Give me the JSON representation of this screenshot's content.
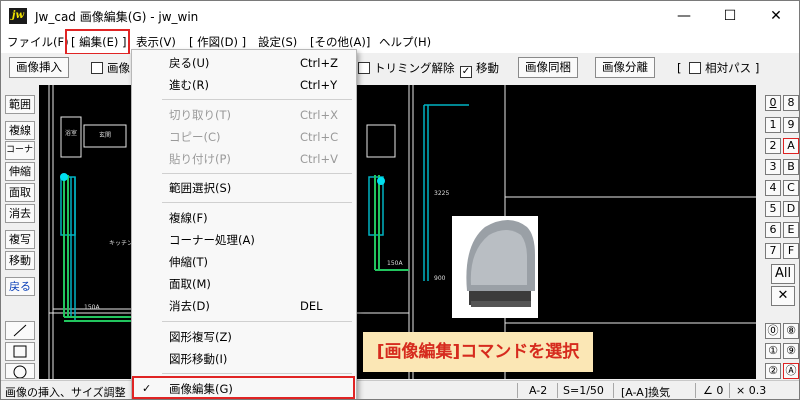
{
  "window": {
    "title": "Jw_cad 画像編集(G) - jw_win",
    "app_icon": "jw",
    "min_glyph": "—",
    "max_glyph": "☐",
    "close_glyph": "✕"
  },
  "menubar": {
    "items": [
      "ファイル(F)",
      "[ 編集(E) ]",
      "表示(V)",
      "[ 作図(D) ]",
      "設定(S)",
      "[その他(A)]",
      "ヘルプ(H)"
    ]
  },
  "toolbar": {
    "insert_image": "画像挿入",
    "image_partial": "画像",
    "trim_cancel": "トリミング解除",
    "move": "移動",
    "move_checked": true,
    "image_sync": "画像同梱",
    "image_split": "画像分離",
    "relative_path": "相対パス",
    "bracket_open": "[",
    "bracket_close": "]"
  },
  "left_palette": [
    "範囲",
    "複線",
    "コーナー",
    "伸縮",
    "面取",
    "消去",
    "複写",
    "移動",
    "戻る"
  ],
  "left_tools": [
    "line-icon",
    "rectangle-icon",
    "circle-icon"
  ],
  "right_palette": {
    "row0": [
      "0",
      "8"
    ],
    "rows": [
      [
        "1",
        "9"
      ],
      [
        "2",
        "A"
      ],
      [
        "3",
        "B"
      ],
      [
        "4",
        "C"
      ],
      [
        "5",
        "D"
      ],
      [
        "6",
        "E"
      ],
      [
        "7",
        "F"
      ]
    ],
    "all": "All",
    "cross": "✕",
    "circled": [
      [
        "⓪",
        "⑧"
      ],
      [
        "①",
        "⑨"
      ],
      [
        "②",
        "Ⓐ"
      ]
    ]
  },
  "edit_menu": {
    "items": [
      {
        "label": "戻る(U)",
        "shortcut": "Ctrl+Z",
        "disabled": false
      },
      {
        "label": "進む(R)",
        "shortcut": "Ctrl+Y",
        "disabled": false
      },
      {
        "label": "切り取り(T)",
        "shortcut": "Ctrl+X",
        "disabled": true
      },
      {
        "label": "コピー(C)",
        "shortcut": "Ctrl+C",
        "disabled": true
      },
      {
        "label": "貼り付け(P)",
        "shortcut": "Ctrl+V",
        "disabled": true
      },
      {
        "label": "範囲選択(S)",
        "shortcut": "",
        "disabled": false
      },
      {
        "label": "複線(F)",
        "shortcut": "",
        "disabled": false
      },
      {
        "label": "コーナー処理(A)",
        "shortcut": "",
        "disabled": false
      },
      {
        "label": "伸縮(T)",
        "shortcut": "",
        "disabled": false
      },
      {
        "label": "面取(M)",
        "shortcut": "",
        "disabled": false
      },
      {
        "label": "消去(D)",
        "shortcut": "DEL",
        "disabled": false
      },
      {
        "label": "図形複写(Z)",
        "shortcut": "",
        "disabled": false
      },
      {
        "label": "図形移動(I)",
        "shortcut": "",
        "disabled": false
      },
      {
        "label": "画像編集(G)",
        "shortcut": "",
        "disabled": false,
        "checked": true
      }
    ]
  },
  "drawing": {
    "labels": [
      "浴室",
      "玄関",
      "キッチン",
      "150A",
      "150A",
      "3225",
      "900"
    ]
  },
  "annotation": "[画像編集]コマンドを選択",
  "statusbar": {
    "message": "画像の挿入、サイズ調整",
    "layer": "A-2",
    "scale": "S=1/50",
    "mode": "[A-A]換気",
    "angle": "∠ 0",
    "mult": "× 0.3"
  },
  "colors": {
    "accent_red": "#e02424",
    "annotation_bg": "#fbe7b5",
    "annotation_text": "#d62b1e",
    "canvas_bg": "#000000",
    "duct_cyan": "#00d7e6",
    "duct_green": "#22c55e"
  }
}
